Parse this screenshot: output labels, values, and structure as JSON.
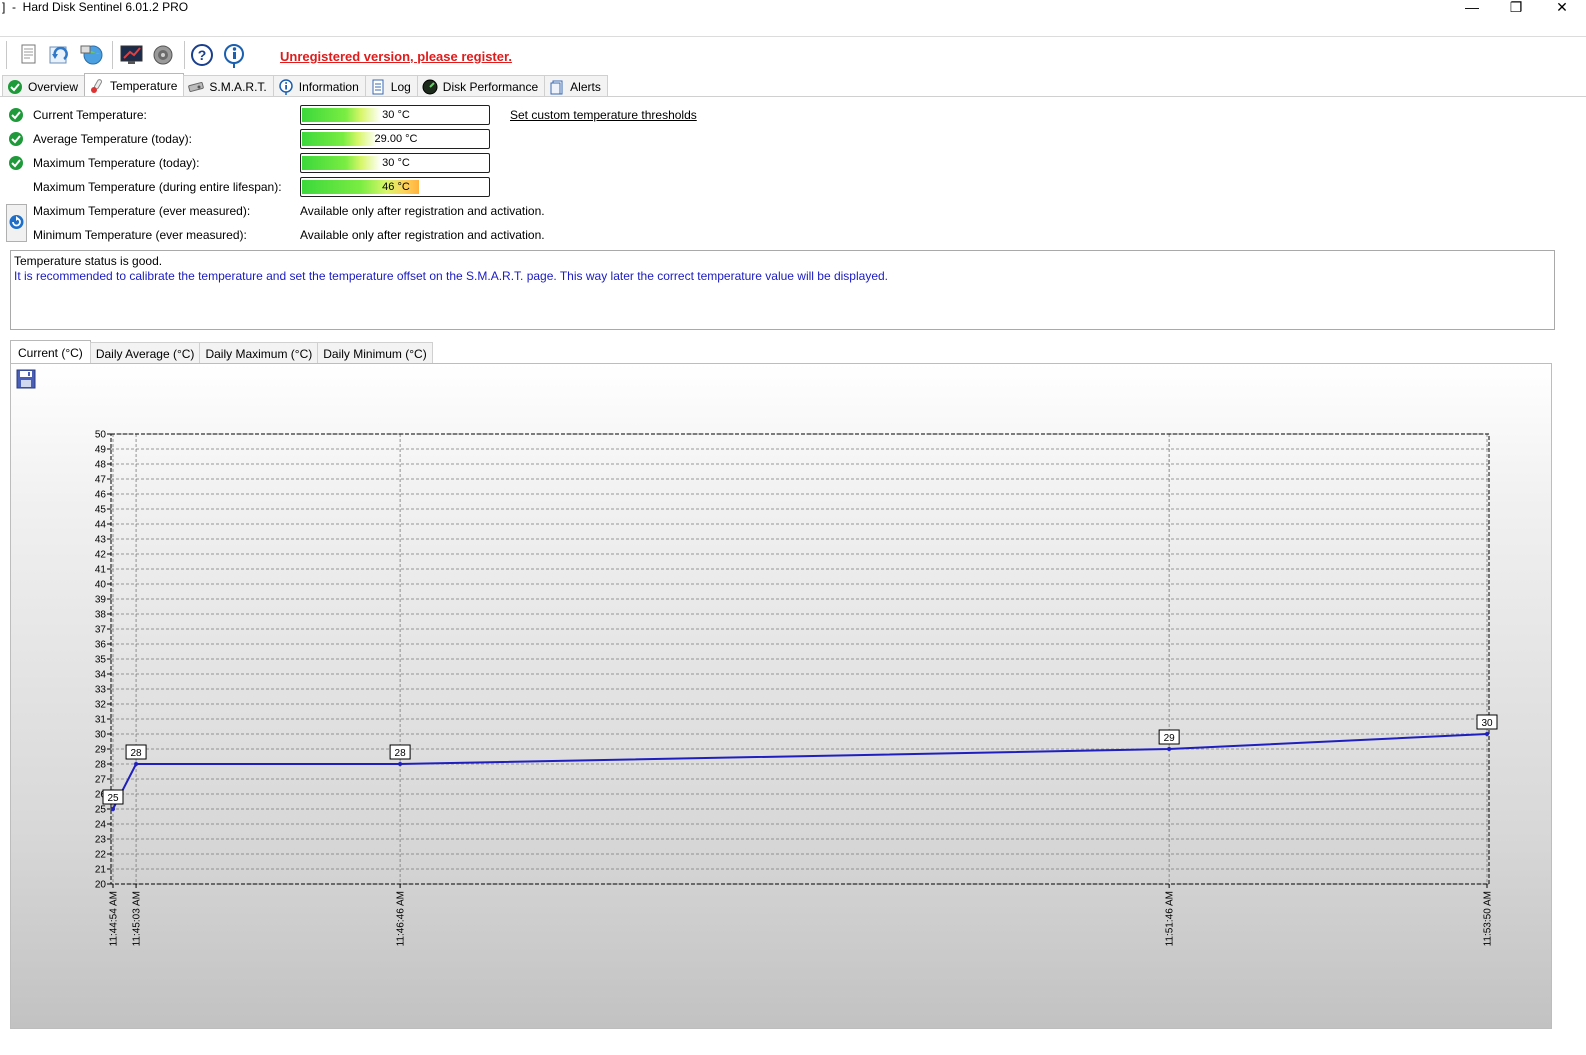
{
  "window": {
    "title": "]  -  Hard Disk Sentinel 6.01.2 PRO",
    "minimize": "—",
    "maximize": "❐",
    "close": "✕"
  },
  "toolbar": {
    "register_label": "Unregistered version, please register.",
    "buttons": [
      "report-icon",
      "refresh-icon",
      "network-icon",
      "monitor-icon",
      "speaker-icon",
      "help-icon",
      "info-icon"
    ]
  },
  "tabs": [
    {
      "label": "Overview",
      "icon": "check-icon"
    },
    {
      "label": "Temperature",
      "icon": "thermometer-icon"
    },
    {
      "label": "S.M.A.R.T.",
      "icon": "disk-icon"
    },
    {
      "label": "Information",
      "icon": "info-icon"
    },
    {
      "label": "Log",
      "icon": "document-icon"
    },
    {
      "label": "Disk Performance",
      "icon": "gauge-icon"
    },
    {
      "label": "Alerts",
      "icon": "clipboard-icon"
    }
  ],
  "temperature": {
    "current": {
      "label": "Current Temperature:",
      "value": "30 °C",
      "level": 0.42
    },
    "average": {
      "label": "Average Temperature (today):",
      "value": "29.00 °C",
      "level": 0.4
    },
    "max_today": {
      "label": "Maximum Temperature (today):",
      "value": "30 °C",
      "level": 0.42
    },
    "max_lifespan": {
      "label": "Maximum Temperature (during entire lifespan):",
      "value": "46 °C",
      "level": 0.62
    },
    "max_ever": {
      "label": "Maximum Temperature (ever measured):",
      "value": "Available only after registration and activation."
    },
    "min_ever": {
      "label": "Minimum Temperature (ever measured):",
      "value": "Available only after registration and activation."
    },
    "thresholds_link": "Set custom temperature thresholds"
  },
  "status": {
    "line1": "Temperature status is good.",
    "line2": "It is recommended to calibrate the temperature and set the temperature offset on the S.M.A.R.T. page. This way later the correct temperature value will be displayed."
  },
  "chart_tabs": [
    "Current (°C)",
    "Daily Average (°C)",
    "Daily Maximum (°C)",
    "Daily Minimum (°C)"
  ],
  "colors": {
    "line": "#1f1fbf",
    "register": "#e01b1b",
    "status_note": "#1b1bc2"
  },
  "chart_data": {
    "type": "line",
    "x": [
      "11:44:54 AM",
      "11:45:03 AM",
      "11:46:46 AM",
      "11:51:46 AM",
      "11:53:50 AM"
    ],
    "x_seconds": [
      0,
      9,
      112,
      412,
      536
    ],
    "values": [
      25,
      28,
      28,
      29,
      30
    ],
    "data_labels": [
      "25",
      "28",
      "28",
      "29",
      "30"
    ],
    "ylim": [
      20,
      50
    ],
    "yticks": [
      20,
      21,
      22,
      23,
      24,
      25,
      26,
      27,
      28,
      29,
      30,
      31,
      32,
      33,
      34,
      35,
      36,
      37,
      38,
      39,
      40,
      41,
      42,
      43,
      44,
      45,
      46,
      47,
      48,
      49,
      50
    ],
    "grid": true,
    "title": "",
    "xlabel": "",
    "ylabel": ""
  }
}
